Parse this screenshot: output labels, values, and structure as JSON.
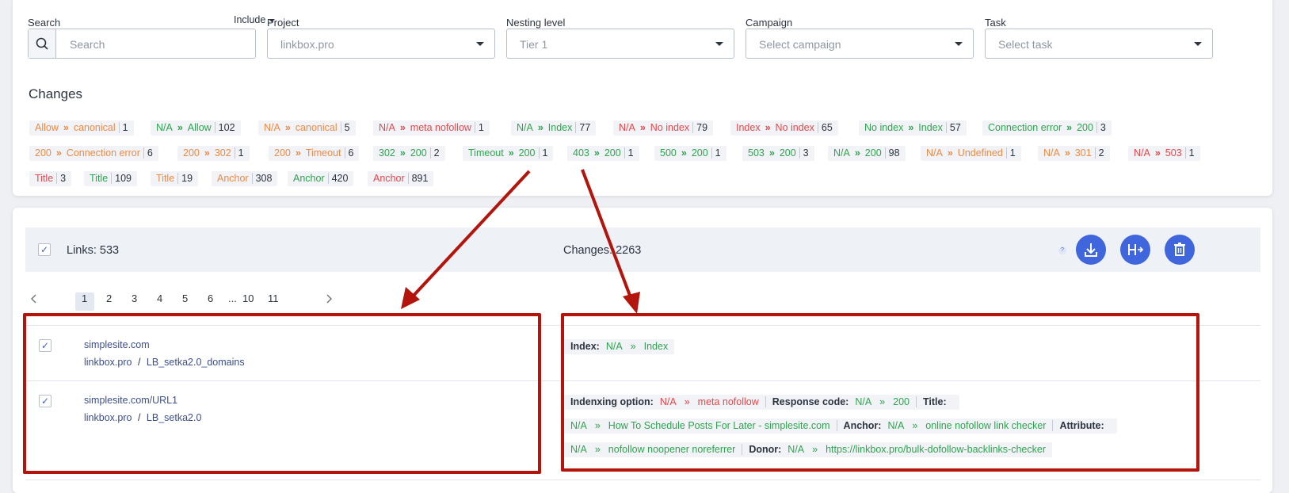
{
  "filters": {
    "search": {
      "label": "Search",
      "placeholder": "Search",
      "mode": "Include"
    },
    "project": {
      "label": "Project",
      "value": "linkbox.pro"
    },
    "nesting": {
      "label": "Nesting level",
      "value": "Tier 1"
    },
    "campaign": {
      "label": "Campaign",
      "value": "Select campaign"
    },
    "task": {
      "label": "Task",
      "value": "Select task"
    }
  },
  "changes": {
    "title": "Changes",
    "chips": [
      {
        "from": "Allow",
        "to": "canonical",
        "count": "1",
        "color": "orange"
      },
      {
        "from": "N/A",
        "to": "Allow",
        "count": "102",
        "color": "green"
      },
      {
        "from": "N/A",
        "to": "canonical",
        "count": "5",
        "color": "orange"
      },
      {
        "from": "N/A",
        "to": "meta nofollow",
        "count": "1",
        "color": "red"
      },
      {
        "from": "N/A",
        "to": "Index",
        "count": "77",
        "color": "green"
      },
      {
        "from": "N/A",
        "to": "No index",
        "count": "79",
        "color": "red"
      },
      {
        "from": "Index",
        "to": "No index",
        "count": "65",
        "color": "red"
      },
      {
        "from": "No index",
        "to": "Index",
        "count": "57",
        "color": "green"
      },
      {
        "from": "Connection error",
        "to": "200",
        "count": "3",
        "color": "green"
      },
      {
        "from": "200",
        "to": "Connection error",
        "count": "6",
        "color": "orange"
      },
      {
        "from": "200",
        "to": "302",
        "count": "1",
        "color": "orange"
      },
      {
        "from": "200",
        "to": "Timeout",
        "count": "6",
        "color": "orange"
      },
      {
        "from": "302",
        "to": "200",
        "count": "2",
        "color": "green"
      },
      {
        "from": "Timeout",
        "to": "200",
        "count": "1",
        "color": "green"
      },
      {
        "from": "403",
        "to": "200",
        "count": "1",
        "color": "green"
      },
      {
        "from": "500",
        "to": "200",
        "count": "1",
        "color": "green"
      },
      {
        "from": "503",
        "to": "200",
        "count": "3",
        "color": "green"
      },
      {
        "from": "N/A",
        "to": "200",
        "count": "98",
        "color": "green"
      },
      {
        "from": "N/A",
        "to": "Undefined",
        "count": "1",
        "color": "orange"
      },
      {
        "from": "N/A",
        "to": "301",
        "count": "2",
        "color": "orange"
      },
      {
        "from": "N/A",
        "to": "503",
        "count": "1",
        "color": "red"
      },
      {
        "from": "Title",
        "to": "",
        "count": "3",
        "color": "red"
      },
      {
        "from": "Title",
        "to": "",
        "count": "109",
        "color": "green"
      },
      {
        "from": "Title",
        "to": "",
        "count": "19",
        "color": "orange"
      },
      {
        "from": "Anchor",
        "to": "",
        "count": "308",
        "color": "orange"
      },
      {
        "from": "Anchor",
        "to": "",
        "count": "420",
        "color": "green"
      },
      {
        "from": "Anchor",
        "to": "",
        "count": "891",
        "color": "red"
      }
    ]
  },
  "summary": {
    "links": "Links: 533",
    "changes": "Changes: 2263",
    "help": "?"
  },
  "pagination": {
    "pages": [
      "1",
      "2",
      "3",
      "4",
      "5",
      "6",
      "...",
      "10",
      "11"
    ],
    "active": "1"
  },
  "rows": [
    {
      "url": "simplesite.com",
      "project": "linkbox.pro",
      "slash": "/",
      "campaign": "LB_setka2.0_domains",
      "lines": [
        [
          {
            "label": "Index:",
            "from": "N/A",
            "to": "Index",
            "color": "green"
          }
        ]
      ]
    },
    {
      "url": "simplesite.com/URL1",
      "project": "linkbox.pro",
      "slash": "/",
      "campaign": "LB_setka2.0",
      "lines": [
        [
          {
            "label": "Indenxing option:",
            "from": "N/A",
            "to": "meta nofollow",
            "color": "red"
          },
          {
            "label": "Response code:",
            "from": "N/A",
            "to": "200",
            "color": "green"
          },
          {
            "label": "Title:",
            "from": "",
            "to": "",
            "color": "green"
          }
        ],
        [
          {
            "label": "",
            "from": "N/A",
            "to": "How To Schedule Posts For Later - simplesite.com",
            "color": "green"
          },
          {
            "label": "Anchor:",
            "from": "N/A",
            "to": "online nofollow link checker",
            "color": "green"
          },
          {
            "label": "Attribute:",
            "from": "",
            "to": "",
            "color": "green"
          }
        ],
        [
          {
            "label": "",
            "from": "N/A",
            "to": "nofollow noopener noreferrer",
            "color": "green"
          },
          {
            "label": "Donor:",
            "from": "N/A",
            "to": "https://linkbox.pro/bulk-dofollow-backlinks-checker",
            "color": "green"
          }
        ]
      ]
    }
  ],
  "colors": {
    "accent": "#3f66dc",
    "green": "#2fa450",
    "orange": "#ef8a45",
    "red": "#e8474c",
    "annotation": "#b3140c"
  }
}
